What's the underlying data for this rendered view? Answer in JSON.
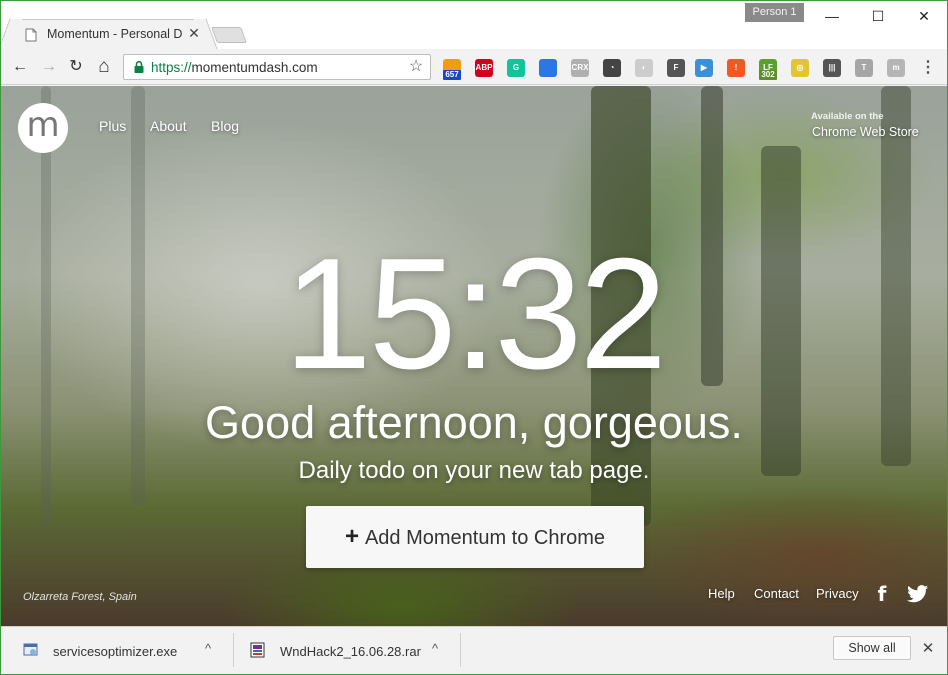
{
  "window": {
    "profile_label": "Person 1",
    "minimize_glyph": "—",
    "maximize_glyph": "☐",
    "close_glyph": "✕"
  },
  "tab": {
    "title": "Momentum - Personal D",
    "close_glyph": "✕"
  },
  "toolbar": {
    "back_glyph": "←",
    "forward_glyph": "→",
    "reload_glyph": "↻",
    "home_glyph": "⌂",
    "url_scheme": "https://",
    "url_host": "momentumdash.com",
    "bookmark_glyph": "☆"
  },
  "extensions": [
    {
      "name": "rss-extension-icon",
      "label": "",
      "color": "#f39c12",
      "badge": "657",
      "badge_color": "#1a47c4"
    },
    {
      "name": "adblock-plus-icon",
      "label": "ABP",
      "color": "#d0021b",
      "badge": ""
    },
    {
      "name": "grammarly-icon",
      "label": "G",
      "color": "#15c39a",
      "badge": ""
    },
    {
      "name": "bookmark-extension-icon",
      "label": "",
      "color": "#2b78e4",
      "badge": ""
    },
    {
      "name": "crx-extension-icon",
      "label": "CRX",
      "color": "#b0b0b0",
      "badge": ""
    },
    {
      "name": "speed-gauge-icon",
      "label": "◔",
      "color": "#444444",
      "badge": ""
    },
    {
      "name": "swirl-extension-icon",
      "label": "◐",
      "color": "#cccccc",
      "badge": ""
    },
    {
      "name": "f-extension-icon",
      "label": "F",
      "color": "#555555",
      "badge": ""
    },
    {
      "name": "play-extension-icon",
      "label": "▶",
      "color": "#3b8fd6",
      "badge": ""
    },
    {
      "name": "alert-extension-icon",
      "label": "!",
      "color": "#f05a22",
      "badge": ""
    },
    {
      "name": "leaf-extension-icon",
      "label": "LF",
      "color": "#5aa02c",
      "badge": "302",
      "badge_color": "#5a8f2a"
    },
    {
      "name": "target-extension-icon",
      "label": "◎",
      "color": "#e3c531",
      "badge": ""
    },
    {
      "name": "equalizer-extension-icon",
      "label": "|||",
      "color": "#555555",
      "badge": ""
    },
    {
      "name": "t-extension-icon",
      "label": "T",
      "color": "#a6a6a6",
      "badge": ""
    },
    {
      "name": "momentum-extension-icon",
      "label": "m",
      "color": "#b5b5b5",
      "badge": ""
    },
    {
      "name": "menu-icon",
      "label": "⋮",
      "color": "#f2f2f2",
      "badge": ""
    }
  ],
  "page": {
    "logo_letter": "m",
    "nav": [
      "Plus",
      "About",
      "Blog"
    ],
    "available_on": "Available on the",
    "store_link": "Chrome Web Store",
    "clock": "15:32",
    "greeting": "Good afternoon, gorgeous.",
    "subtitle": "Daily todo on your new tab page.",
    "cta_icon": "+",
    "cta_label": "Add Momentum to Chrome",
    "photo_credit": "Olzarreta Forest, Spain",
    "footer_links": [
      "Help",
      "Contact",
      "Privacy"
    ],
    "facebook_glyph": "f",
    "twitter_glyph": "🐦"
  },
  "downloads": {
    "items": [
      {
        "filename": "servicesoptimizer.exe",
        "caret": "^"
      },
      {
        "filename": "WndHack2_16.06.28.rar",
        "caret": "^"
      }
    ],
    "show_all": "Show all",
    "close_glyph": "✕"
  }
}
